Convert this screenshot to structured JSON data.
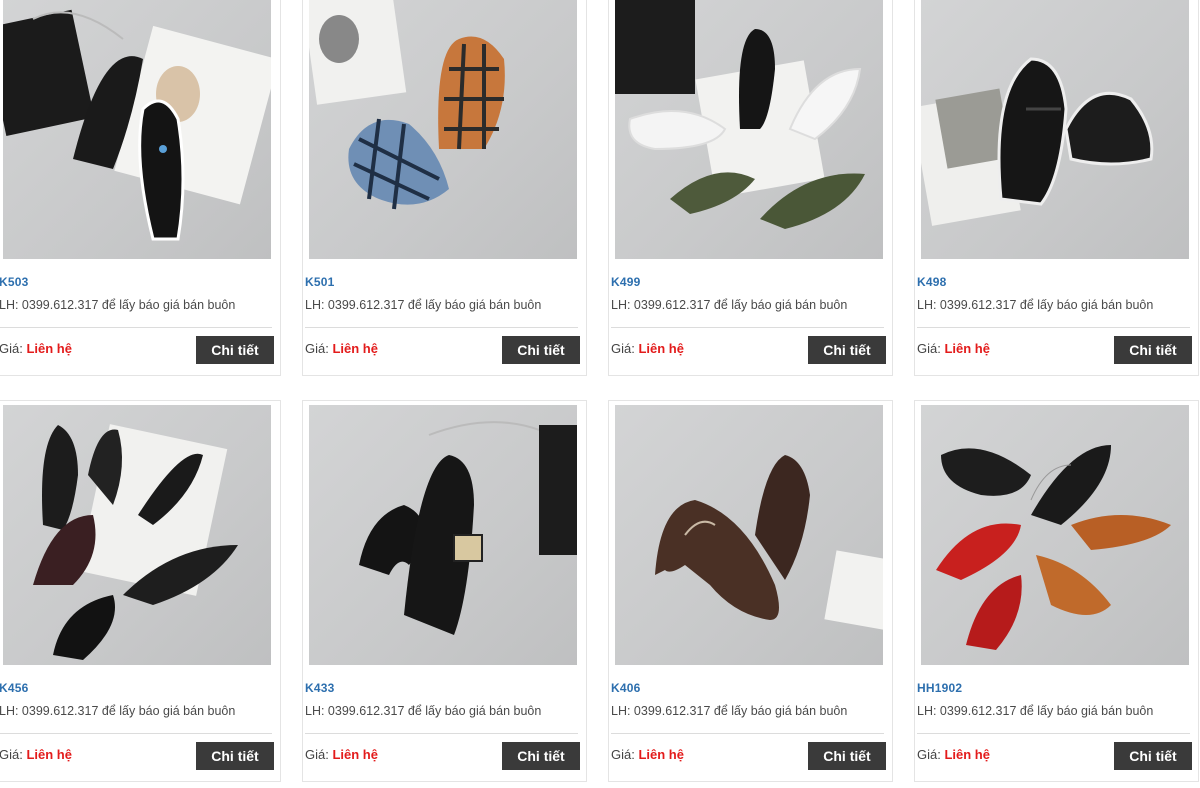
{
  "products": [
    {
      "code": "K503",
      "contact": "LH: 0399.612.317 để lấy báo giá bán buôn",
      "price_label": "Giá: ",
      "price_value": "Liên hệ",
      "button": "Chi tiết",
      "image": "black-slip-on-shoes-photo"
    },
    {
      "code": "K501",
      "contact": "LH: 0399.612.317 để lấy báo giá bán buôn",
      "price_label": "Giá: ",
      "price_value": "Liên hệ",
      "button": "Chi tiết",
      "image": "plaid-slip-on-shoes-photo"
    },
    {
      "code": "K499",
      "contact": "LH: 0399.612.317 để lấy báo giá bán buôn",
      "price_label": "Giá: ",
      "price_value": "Liên hệ",
      "button": "Chi tiết",
      "image": "loafers-multi-color-photo"
    },
    {
      "code": "K498",
      "contact": "LH: 0399.612.317 để lấy báo giá bán buôn",
      "price_label": "Giá: ",
      "price_value": "Liên hệ",
      "button": "Chi tiết",
      "image": "black-woven-loafers-photo"
    },
    {
      "code": "K456",
      "contact": "LH: 0399.612.317 để lấy báo giá bán buôn",
      "price_label": "Giá: ",
      "price_value": "Liên hệ",
      "button": "Chi tiết",
      "image": "black-pointed-pumps-photo"
    },
    {
      "code": "K433",
      "contact": "LH: 0399.612.317 để lấy báo giá bán buôn",
      "price_label": "Giá: ",
      "price_value": "Liên hệ",
      "button": "Chi tiết",
      "image": "black-kitten-heels-photo"
    },
    {
      "code": "K406",
      "contact": "LH: 0399.612.317 để lấy báo giá bán buôn",
      "price_label": "Giá: ",
      "price_value": "Liên hệ",
      "button": "Chi tiết",
      "image": "brown-pumps-photo"
    },
    {
      "code": "HH1902",
      "contact": "LH: 0399.612.317 để lấy báo giá bán buôn",
      "price_label": "Giá: ",
      "price_value": "Liên hệ",
      "button": "Chi tiết",
      "image": "colorful-moccasins-photo"
    }
  ],
  "colors": {
    "code": "#2d6fae",
    "price_value": "#e31b1b",
    "button_bg": "#3a3a3a",
    "photo_bg": "#cfd0d1"
  }
}
